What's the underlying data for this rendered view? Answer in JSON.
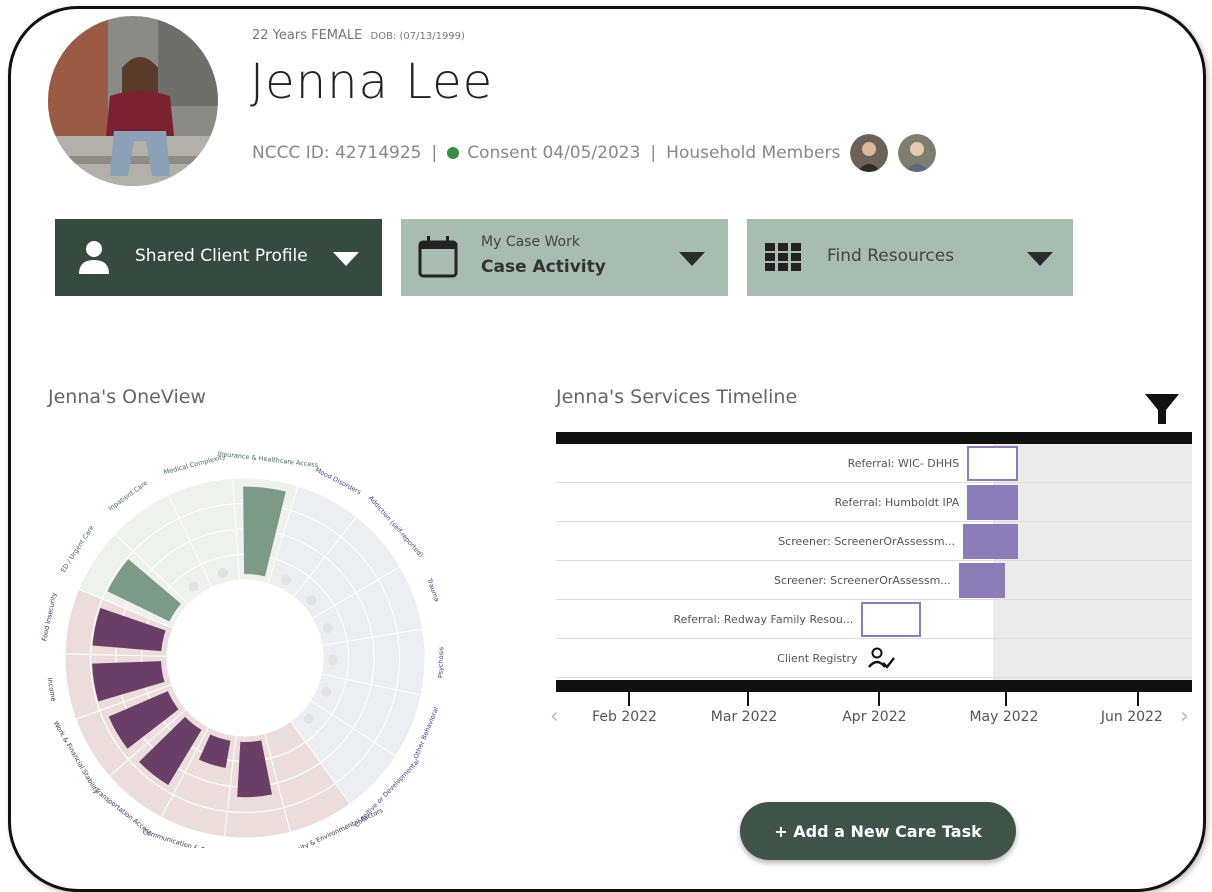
{
  "header": {
    "age_gender": "22 Years FEMALE",
    "dob": "DOB: (07/13/1999)",
    "name": "Jenna Lee",
    "nccc_id": "NCCC ID: 42714925",
    "consent": "Consent 04/05/2023",
    "household_label": "Household Members",
    "sep1": "|",
    "sep2": "|",
    "status_color": "#3c8a45"
  },
  "nav": {
    "shared_profile": "Shared Client Profile",
    "case_work_top": "My Case Work",
    "case_work_bottom": "Case Activity",
    "find_resources": "Find Resources",
    "dark_color": "#364a40",
    "light_color": "#a9bcb1"
  },
  "oneview": {
    "title": "Jenna's OneView",
    "colors": {
      "green_bg": "#eef1ec",
      "blue_bg": "#eceef2",
      "pink_bg": "#ecdcdc",
      "green_bar": "#7c9a87",
      "purple_bar": "#6a3f67"
    },
    "segments": [
      {
        "label": "Insurance & Healthcare Access",
        "group": "green",
        "level": 0.95
      },
      {
        "label": "Mood Disorders",
        "group": "blue",
        "level": 0
      },
      {
        "label": "Addiction (self-reported)",
        "group": "blue",
        "level": 0
      },
      {
        "label": "Trauma",
        "group": "blue",
        "level": 0
      },
      {
        "label": "Psychosis",
        "group": "blue",
        "level": 0
      },
      {
        "label": "Other Behavioral",
        "group": "blue",
        "level": 0
      },
      {
        "label": "Cognitive or Developmental",
        "group": "blue",
        "level": 0
      },
      {
        "label": "Community & Environmental Factors",
        "group": "pink",
        "level": 0
      },
      {
        "label": "Household & Family Structure",
        "group": "pink",
        "level": 0.6
      },
      {
        "label": "Communication & Education",
        "group": "pink",
        "level": 0.3
      },
      {
        "label": "Transportation Access",
        "group": "pink",
        "level": 0.7
      },
      {
        "label": "Work & Financial Stability",
        "group": "pink",
        "level": 0.7
      },
      {
        "label": "Income",
        "group": "pink",
        "level": 0.75
      },
      {
        "label": "Food Insecurity",
        "group": "pink",
        "level": 0.75
      },
      {
        "label": "ED / Urgent Care",
        "group": "green",
        "level": 0.75
      },
      {
        "label": "Inpatient Care",
        "group": "green",
        "level": 0
      },
      {
        "label": "Medical Complexity",
        "group": "green",
        "level": 0
      }
    ]
  },
  "timeline": {
    "title": "Jenna's Services Timeline",
    "rows": [
      {
        "label": "Referral: WIC- DHHS",
        "start": "2022-04-22",
        "end": "2022-05-04",
        "filled": false
      },
      {
        "label": "Referral: Humboldt IPA",
        "start": "2022-04-22",
        "end": "2022-05-04",
        "filled": true
      },
      {
        "label": "Screener: ScreenerOrAssessm...",
        "start": "2022-04-21",
        "end": "2022-05-04",
        "filled": true
      },
      {
        "label": "Screener: ScreenerOrAssessm...",
        "start": "2022-04-20",
        "end": "2022-05-01",
        "filled": true
      },
      {
        "label": "Referral: Redway Family Resou...",
        "start": "2022-03-28",
        "end": "2022-04-11",
        "filled": false
      },
      {
        "label": "Client Registry",
        "start": "2022-03-29",
        "end": "2022-03-29",
        "filled": false
      }
    ],
    "ticks": [
      "Feb 2022",
      "Mar 2022",
      "Apr 2022",
      "May 2022",
      "Jun 2022"
    ],
    "prev": "‹",
    "next": "›",
    "bar_color": "#8b7eb8",
    "shade_color": "#ebebeb"
  },
  "actions": {
    "add_task": "+ Add a New Care Task"
  }
}
